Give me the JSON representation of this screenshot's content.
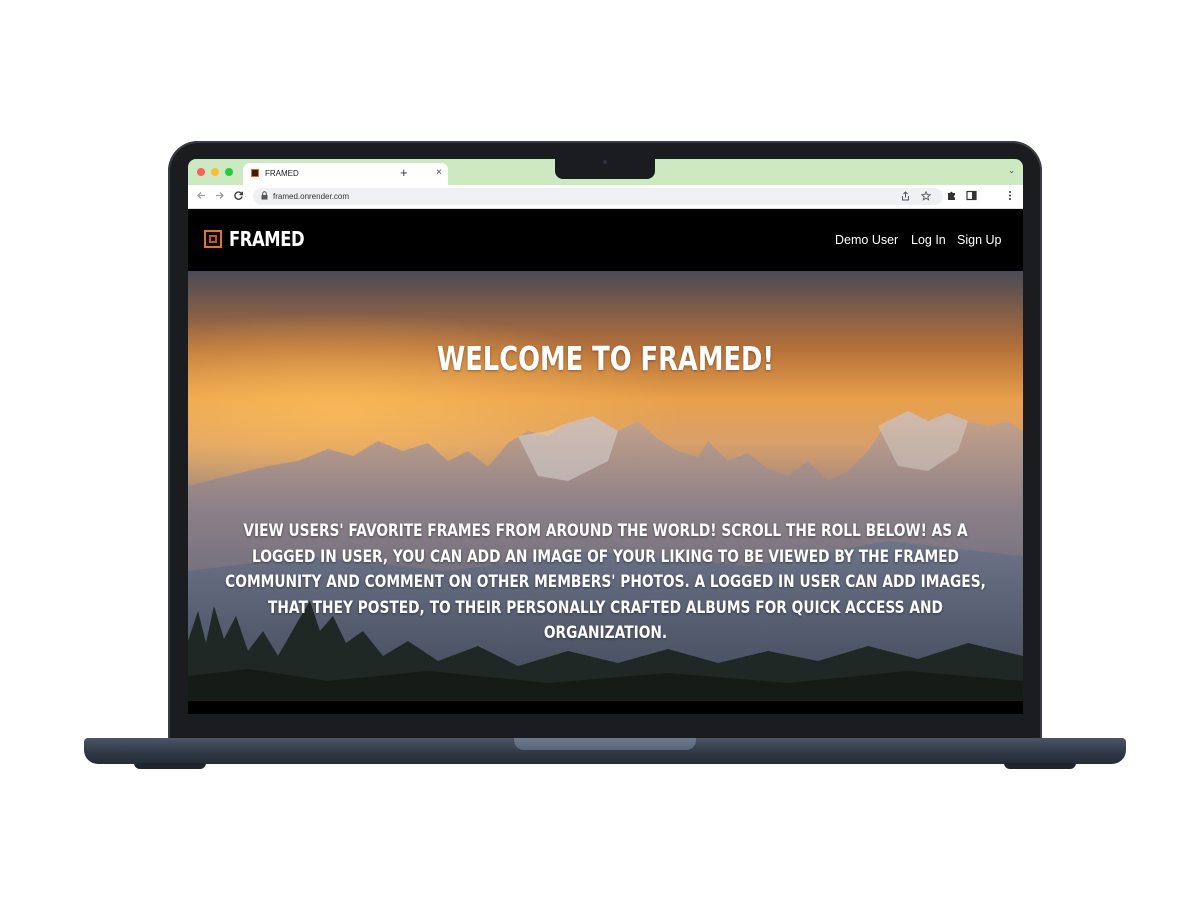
{
  "browser": {
    "tab_title": "FRAMED",
    "tab_close": "×",
    "new_tab": "+",
    "tab_menu": "⌄",
    "url": "framed.onrender.com"
  },
  "site": {
    "logo_text": "FRAMED",
    "nav": [
      {
        "label": "Demo User"
      },
      {
        "label": "Log In"
      },
      {
        "label": "Sign Up"
      }
    ]
  },
  "hero": {
    "title": "WELCOME TO FRAMED!",
    "body": "View users' favorite frames from around the world! Scroll the roll below! As a logged in user, you can add an image of your liking to be viewed by the Framed community and comment on other members' photos. A logged in user can add images, that they posted, to their personally crafted albums for quick access and organization."
  },
  "colors": {
    "tab_bar": "#cde9c2",
    "logo_accent": "#e4742c",
    "traffic_red": "#fe5f57",
    "traffic_yellow": "#febc2e",
    "traffic_green": "#28c840"
  }
}
